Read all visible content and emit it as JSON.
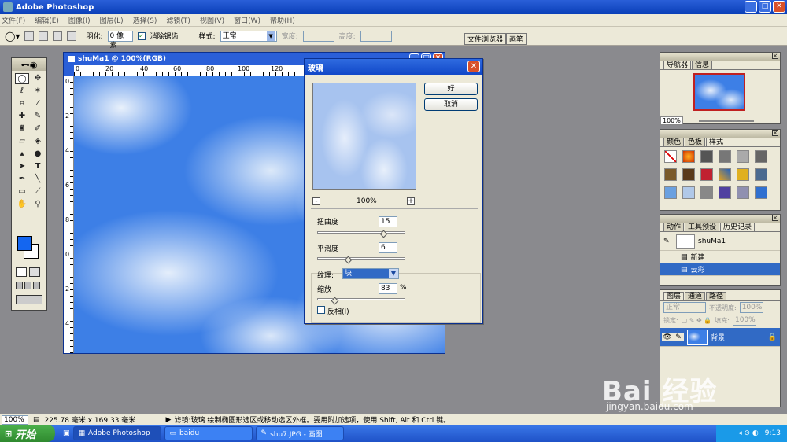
{
  "window": {
    "title": "Adobe Photoshop",
    "min": "_",
    "max": "□",
    "close": "✕"
  },
  "menu": [
    "文件(F)",
    "编辑(E)",
    "图像(I)",
    "图层(L)",
    "选择(S)",
    "滤镜(T)",
    "视图(V)",
    "窗口(W)",
    "帮助(H)"
  ],
  "options": {
    "feather_label": "羽化:",
    "feather_value": "0 像素",
    "antialias_label": "消除锯齿",
    "style_label": "样式:",
    "style_value": "正常",
    "width_label": "宽度:",
    "height_label": "高度:",
    "file_browser": "文件浏览器",
    "brushes": "画笔"
  },
  "document": {
    "title": "shuMa1 @ 100%(RGB)",
    "ruler_top": [
      "0",
      "20",
      "40",
      "60",
      "80",
      "100",
      "120"
    ],
    "ruler_left": [
      "0",
      "2",
      "4",
      "6",
      "8",
      "0",
      "2",
      "4"
    ]
  },
  "dialog": {
    "title": "玻璃",
    "ok": "好",
    "cancel": "取消",
    "zoom_value": "100%",
    "zoom_minus": "-",
    "zoom_plus": "+",
    "distortion_label": "扭曲度",
    "distortion_value": "15",
    "distortion_level": 0.75,
    "smoothness_label": "平滑度",
    "smoothness_value": "6",
    "smoothness_level": 0.35,
    "texture_label": "纹理:",
    "texture_value": "块",
    "scale_label": "缩放",
    "scale_value": "83",
    "scale_unit": "%",
    "scale_level": 0.2,
    "invert_label": "反相(I)"
  },
  "navigator": {
    "tab1": "导航器",
    "tab2": "信息",
    "zoom": "100%"
  },
  "swatches": {
    "tab1": "颜色",
    "tab2": "色板",
    "tab3": "样式"
  },
  "history": {
    "tab1": "动作",
    "tab2": "工具预设",
    "tab3": "历史记录",
    "snapshot": "shuMa1",
    "items": [
      {
        "label": "新建"
      },
      {
        "label": "云彩"
      }
    ]
  },
  "layers": {
    "tab1": "图层",
    "tab2": "通道",
    "tab3": "路径",
    "mode": "正常",
    "opacity_label": "不透明度:",
    "opacity": "100%",
    "lock_label": "锁定:",
    "fill_label": "填充:",
    "fill": "100%",
    "layer_name": "背景"
  },
  "status": {
    "zoom": "100%",
    "doc_size": "225.78 毫米 x 169.33 毫米",
    "hint": "滤镜:玻璃  绘制椭圆形选区或移动选区外框。要用附加选项，使用 Shift, Alt 和 Ctrl 键。"
  },
  "taskbar": {
    "start": "开始",
    "items": [
      "Adobe Photoshop",
      "baidu",
      "shu7.JPG - 画图"
    ],
    "clock": "9:13"
  },
  "watermark": {
    "logo": "Bai 经验",
    "url": "jingyan.baidu.com"
  },
  "colors": {
    "foreground": "#1466f0",
    "background": "#ffffff",
    "accent": "#316ac5"
  }
}
